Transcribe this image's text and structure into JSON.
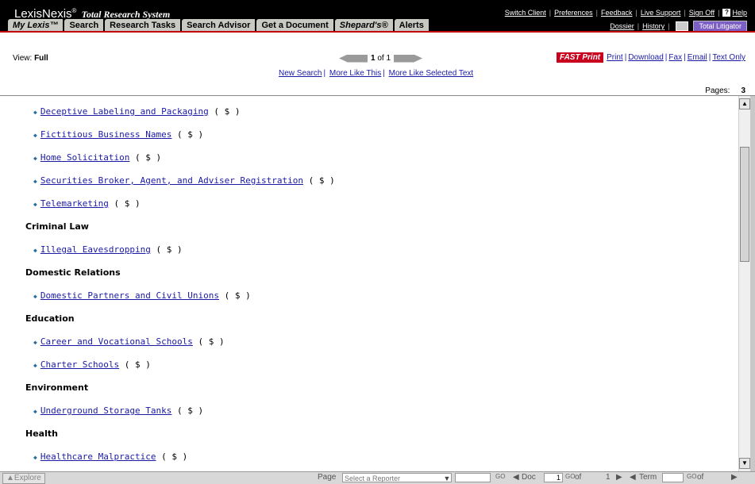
{
  "app": {
    "brand": "LexisNexis",
    "brand_mark": "®",
    "subtitle": "Total Research System"
  },
  "toplinks": [
    "Switch Client",
    "Preferences",
    "Feedback",
    "Live Support",
    "Sign Off"
  ],
  "help_label": "Help",
  "tabs": [
    {
      "label": "My Lexis™"
    },
    {
      "label": "Search"
    },
    {
      "label": "Research Tasks"
    },
    {
      "label": "Search Advisor"
    },
    {
      "label": "Get a Document"
    },
    {
      "label": "Shepard's®"
    },
    {
      "label": "Alerts"
    }
  ],
  "secondary_links": [
    "Dossier",
    "History"
  ],
  "total_litigator": "Total Litigator",
  "view": {
    "label": "View:",
    "value": "Full"
  },
  "pager": {
    "current": "1",
    "of_text": "of 1"
  },
  "subnav": [
    "New Search",
    "More Like This",
    "More Like Selected Text"
  ],
  "print": {
    "fast_print": "FAST Print",
    "links": [
      "Print",
      "Download",
      "Fax",
      "Email",
      "Text Only"
    ]
  },
  "pages": {
    "label": "Pages:",
    "value": "3"
  },
  "content": [
    {
      "type": "item",
      "text": "Deceptive Labeling and Packaging",
      "suffix": "( $ )"
    },
    {
      "type": "item",
      "text": "Fictitious Business Names",
      "suffix": "( $ )"
    },
    {
      "type": "item",
      "text": "Home Solicitation",
      "suffix": "( $ )"
    },
    {
      "type": "item",
      "text": "Securities Broker, Agent, and Adviser Registration",
      "suffix": "( $ )"
    },
    {
      "type": "item",
      "text": "Telemarketing",
      "suffix": "( $ )"
    },
    {
      "type": "heading",
      "text": "Criminal Law"
    },
    {
      "type": "item",
      "text": "Illegal Eavesdropping",
      "suffix": "( $ )"
    },
    {
      "type": "heading",
      "text": "Domestic Relations"
    },
    {
      "type": "item",
      "text": "Domestic Partners and Civil Unions",
      "suffix": "( $ )"
    },
    {
      "type": "heading",
      "text": "Education"
    },
    {
      "type": "item",
      "text": "Career and Vocational Schools",
      "suffix": "( $ )"
    },
    {
      "type": "item",
      "text": "Charter Schools",
      "suffix": "( $ )"
    },
    {
      "type": "heading",
      "text": "Environment"
    },
    {
      "type": "item",
      "text": "Underground Storage Tanks",
      "suffix": "( $ )"
    },
    {
      "type": "heading",
      "text": "Health"
    },
    {
      "type": "item",
      "text": "Healthcare Malpractice",
      "suffix": "( $ )"
    }
  ],
  "bottom": {
    "explore": "Explore",
    "page_label": "Page",
    "reporter_placeholder": "Select a Reporter",
    "doc_label": "Doc",
    "doc_value": "1",
    "doc_of": "of",
    "doc_total": "1",
    "term_label": "Term",
    "term_of": "of",
    "go": "GO"
  },
  "colors": {
    "accent_red": "#c8001e",
    "link_blue": "#1a1aa6",
    "bullet_teal": "#2a6e9e",
    "total_litigator": "#7b5fc4"
  }
}
